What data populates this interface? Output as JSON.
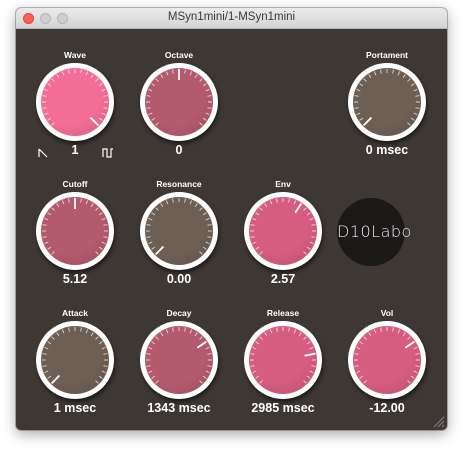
{
  "window": {
    "title": "MSyn1mini/1-MSyn1mini"
  },
  "logo": {
    "text": "D10Labo"
  },
  "colors": {
    "panel": "#3e3835",
    "pink_bright": "#f26d97",
    "rose": "#b35a6e",
    "brown": "#6e5f55",
    "pink": "#d55d7f"
  },
  "params": [
    {
      "id": "wave",
      "label": "Wave",
      "value": "1",
      "level": 1.0,
      "color": "pink_bright"
    },
    {
      "id": "octave",
      "label": "Octave",
      "value": "0",
      "level": 0.5,
      "color": "rose"
    },
    {
      "id": "portament",
      "label": "Portament",
      "value": "0 msec",
      "level": 0.0,
      "color": "brown"
    },
    {
      "id": "cutoff",
      "label": "Cutoff",
      "value": "5.12",
      "level": 0.5,
      "color": "rose"
    },
    {
      "id": "resonance",
      "label": "Resonance",
      "value": "0.00",
      "level": 0.0,
      "color": "brown"
    },
    {
      "id": "env",
      "label": "Env",
      "value": "2.57",
      "level": 0.63,
      "color": "pink"
    },
    {
      "id": "attack",
      "label": "Attack",
      "value": "1 msec",
      "level": 0.0,
      "color": "brown"
    },
    {
      "id": "decay",
      "label": "Decay",
      "value": "1343 msec",
      "level": 0.7,
      "color": "rose"
    },
    {
      "id": "release",
      "label": "Release",
      "value": "2985 msec",
      "level": 0.8,
      "color": "pink"
    },
    {
      "id": "vol",
      "label": "Vol",
      "value": "-12.00",
      "level": 0.7,
      "color": "pink"
    }
  ],
  "icons": {
    "wave_min": "sawtooth-wave-icon",
    "wave_max": "square-wave-icon"
  }
}
